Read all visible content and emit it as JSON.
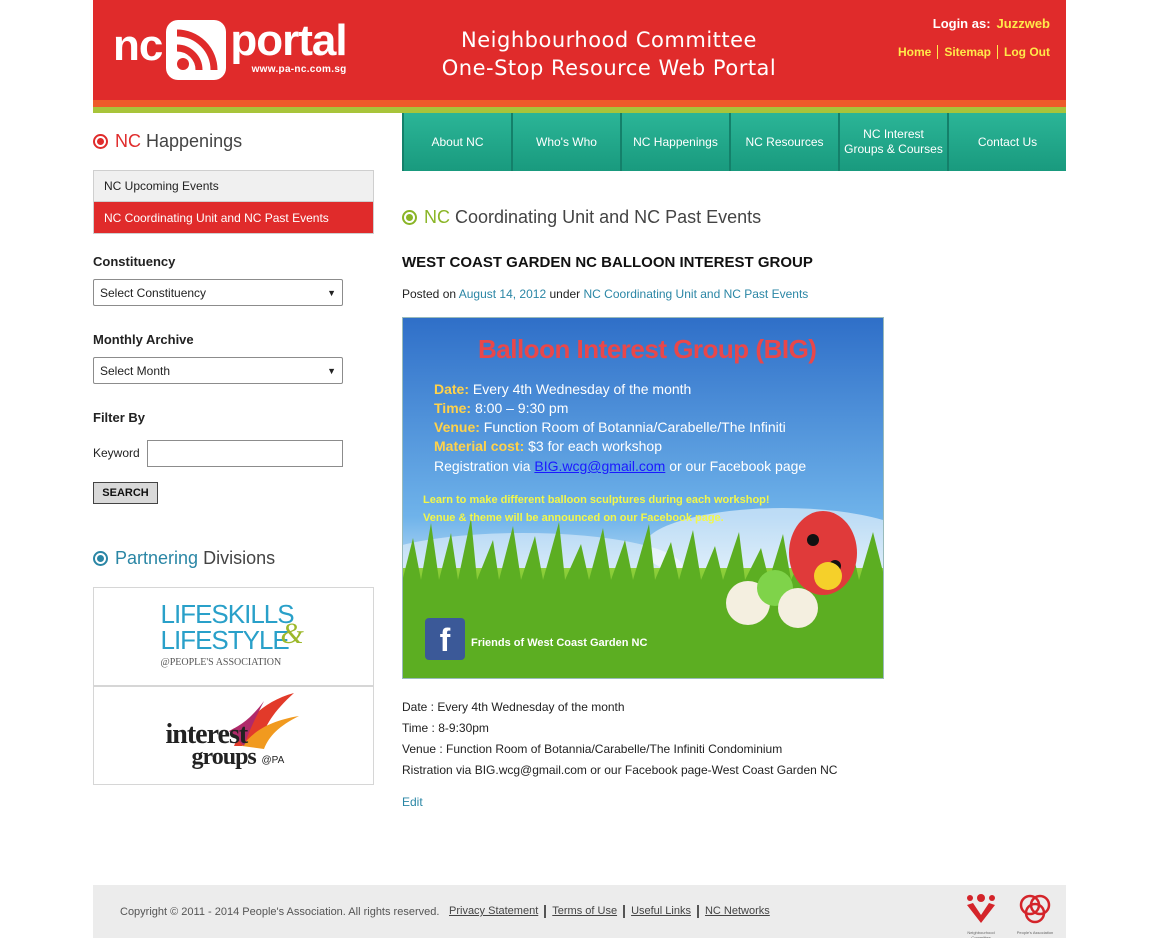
{
  "header": {
    "logo_nc": "nc",
    "logo_portal": "portal",
    "logo_url": "www.pa-nc.com.sg",
    "title_line1": "Neighbourhood Committee",
    "title_line2": "One-Stop Resource Web Portal",
    "login_label": "Login as:",
    "login_user": "Juzzweb",
    "links": [
      "Home",
      "Sitemap",
      "Log Out"
    ]
  },
  "nav": {
    "items": [
      "About NC",
      "Who's Who",
      "NC Happenings",
      "NC Resources",
      "NC Interest Groups & Courses",
      "Contact Us"
    ]
  },
  "sidebar": {
    "happenings_heading_hl": "NC",
    "happenings_heading_rest": "Happenings",
    "menu": [
      "NC Upcoming Events",
      "NC Coordinating Unit and NC Past Events"
    ],
    "constituency_label": "Constituency",
    "constituency_select": "Select Constituency",
    "archive_label": "Monthly Archive",
    "archive_select": "Select Month",
    "filter_label": "Filter By",
    "keyword_label": "Keyword",
    "keyword_value": "",
    "search_button": "SEARCH",
    "partner_heading_hl": "Partnering",
    "partner_heading_rest": "Divisions",
    "partner1_line1": "LIFESKILLS",
    "partner1_line2": "LIFESTYLE",
    "partner1_amp": "&",
    "partner1_sub": "@PEOPLE'S ASSOCIATION",
    "partner2_line1": "interest",
    "partner2_line2": "groups",
    "partner2_sub": "@PA"
  },
  "main": {
    "heading_hl": "NC",
    "heading_rest": "Coordinating Unit and NC Past Events",
    "post_title": "WEST COAST GARDEN NC BALLOON INTEREST GROUP",
    "posted_on": "Posted on",
    "post_date": "August 14, 2012",
    "under": "under",
    "category": "NC Coordinating Unit and NC Past Events",
    "poster": {
      "title": "Balloon Interest Group (BIG)",
      "date_label": "Date:",
      "date_value": "Every 4th Wednesday of the month",
      "time_label": "Time:",
      "time_value": "8:00 – 9:30 pm",
      "venue_label": "Venue:",
      "venue_value": "Function Room of Botannia/Carabelle/The Infiniti",
      "cost_label": "Material cost:",
      "cost_value": "$3 for each workshop",
      "reg_prefix": "Registration via",
      "reg_email": "BIG.wcg@gmail.com",
      "reg_suffix": "or our Facebook page",
      "learn_line1": "Learn to make different balloon sculptures during each workshop!",
      "learn_line2": "Venue & theme will be announced on our Facebook page.",
      "facebook_label": "Friends of West Coast Garden NC"
    },
    "body": [
      "Date : Every 4th Wednesday of the month",
      "Time : 8-9:30pm",
      "Venue : Function Room of Botannia/Carabelle/The Infiniti Condominium",
      "Ristration via BIG.wcg@gmail.com or our Facebook page-West Coast Garden NC"
    ],
    "edit_link": "Edit"
  },
  "footer": {
    "copyright": "Copyright © 2011 - 2014 People's Association. All rights reserved.",
    "links": [
      "Privacy Statement",
      "Terms of Use",
      "Useful Links",
      "NC Networks"
    ],
    "logo1_caption": "Neighbourhood Committee",
    "logo2_caption": "People's Association"
  },
  "colors": {
    "brand_red": "#e02b2b",
    "nav_teal": "#1fa487",
    "link_blue": "#2a86a5",
    "accent_green": "#8ab526",
    "link_yellow": "#ffe94a"
  }
}
